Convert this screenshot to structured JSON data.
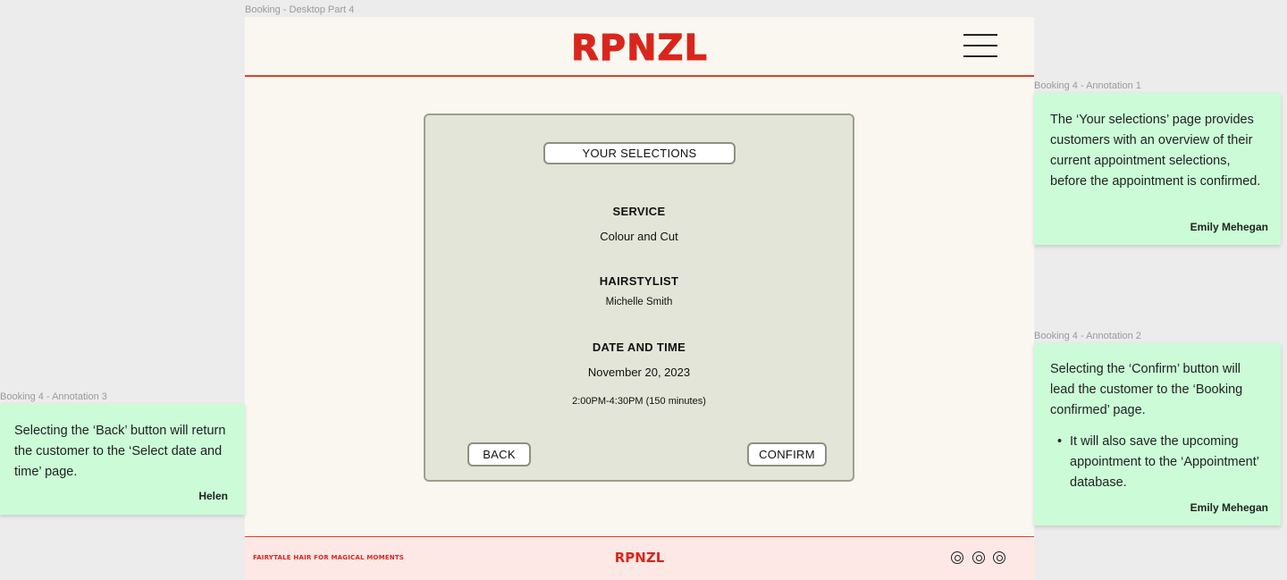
{
  "frame_label": "Booking - Desktop Part 4",
  "header": {
    "logo": "RPNZL"
  },
  "card": {
    "title": "YOUR SELECTIONS",
    "service": {
      "heading": "SERVICE",
      "value": "Colour and Cut"
    },
    "hairstylist": {
      "heading": "HAIRSTYLIST",
      "value": "Michelle Smith"
    },
    "datetime": {
      "heading": "DATE AND TIME",
      "date": "November 20, 2023",
      "time": "2:00PM-4:30PM (150 minutes)"
    },
    "back_label": "BACK",
    "confirm_label": "CONFIRM"
  },
  "footer": {
    "tagline": "Fairytale hair for magical moments",
    "logo": "RPNZL"
  },
  "annotations": [
    {
      "label": "Booking 4 - Annotation 1",
      "text": "The ‘Your selections’ page provides customers with an overview of their current appointment selections, before the appointment is confirmed.",
      "author": "Emily Mehegan"
    },
    {
      "label": "Booking 4 - Annotation 2",
      "text": "Selecting the ‘Confirm’ button will lead the customer to the ‘Booking confirmed’ page.",
      "bullet": "It will also save the upcoming appointment to the ‘Appointment’ database.",
      "author": "Emily Mehegan"
    },
    {
      "label": "Booking 4 - Annotation 3",
      "text": "Selecting the ‘Back’ button will return the customer to the ‘Select date and time’ page.",
      "author": "Helen"
    }
  ],
  "colors": {
    "brand_red": "#d9261c",
    "note_green": "#cbfcd7",
    "card_bg": "#e3e5d8",
    "page_bg": "#faf7f0"
  }
}
